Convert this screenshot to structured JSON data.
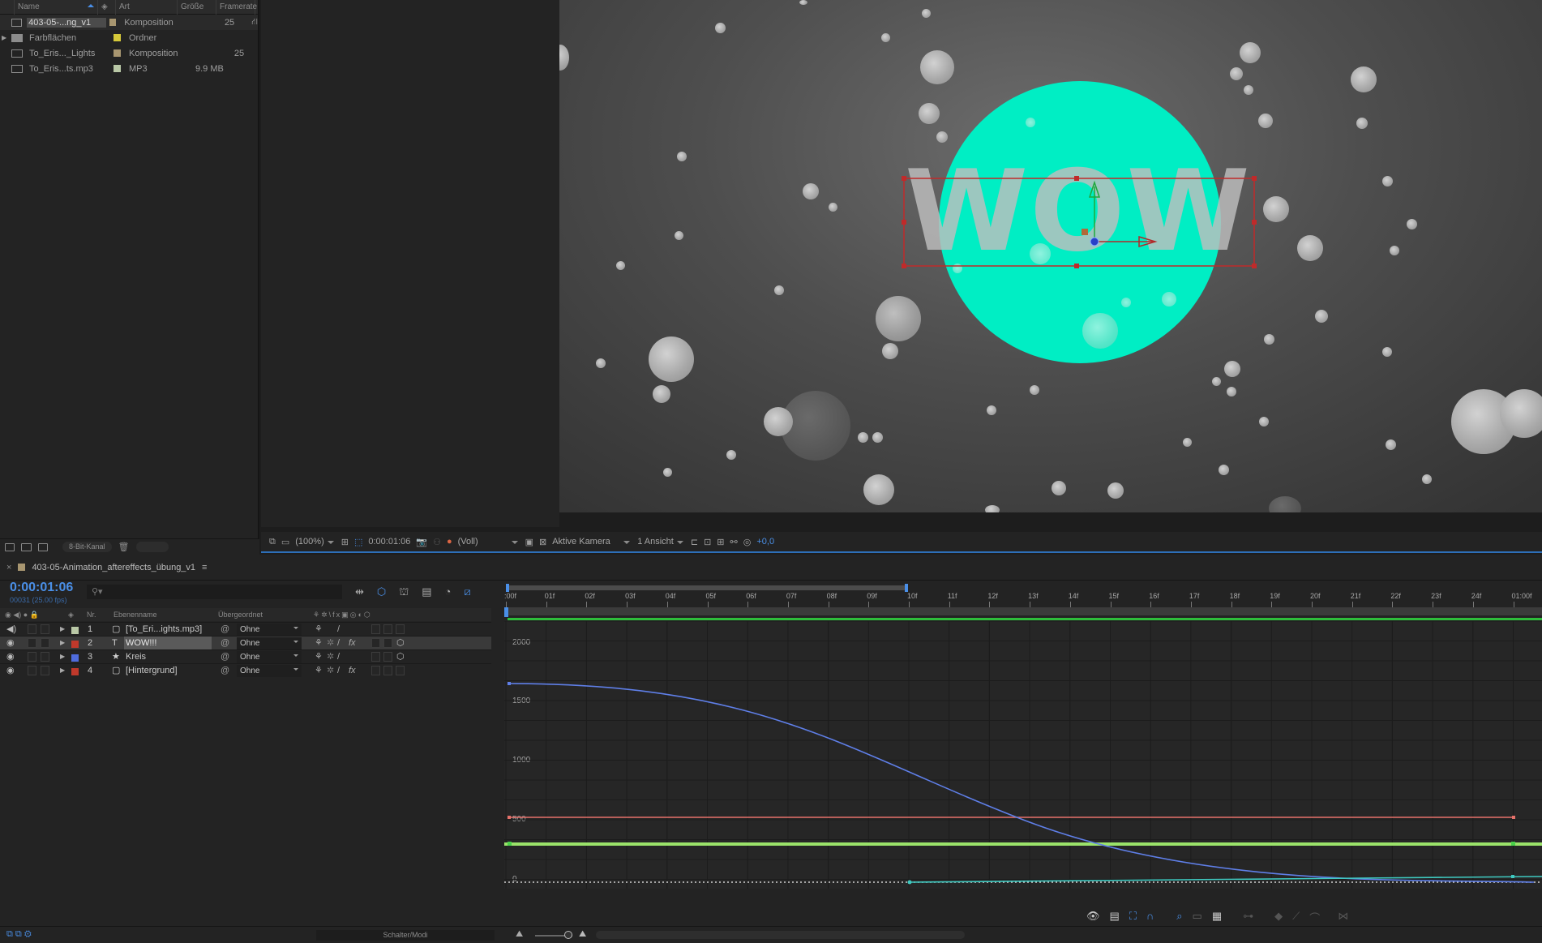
{
  "project": {
    "columns": {
      "name": "Name",
      "type": "Art",
      "size": "Größe",
      "framerate": "Framerate"
    },
    "items": [
      {
        "name": "403-05-...ng_v1",
        "type": "Komposition",
        "size": "",
        "framerate": "25",
        "swatch": "#a89670",
        "selected": true
      },
      {
        "name": "Farbflächen",
        "type": "Ordner",
        "size": "",
        "framerate": "",
        "swatch": "#d6c93a",
        "selected": false
      },
      {
        "name": "To_Eris..._Lights",
        "type": "Komposition",
        "size": "",
        "framerate": "25",
        "swatch": "#a89670",
        "selected": false
      },
      {
        "name": "To_Eris...ts.mp3",
        "type": "MP3",
        "size": "9.9 MB",
        "framerate": "",
        "swatch": "#b9c8a6",
        "selected": false
      }
    ],
    "bit_depth": "8-Bit-Kanal"
  },
  "viewer": {
    "overlay_text": "WOW!",
    "circle_color": "#00eec4",
    "zoom": "(100%)",
    "timecode": "0:00:01:06",
    "resolution": "(Voll)",
    "camera": "Aktive Kamera",
    "views": "1 Ansicht",
    "exposure": "+0,0"
  },
  "timeline": {
    "comp_tab": "403-05-Animation_aftereffects_übung_v1",
    "current_time": "0:00:01:06",
    "frame_info": "00031 (25.00 fps)",
    "search_placeholder": "",
    "columns": {
      "nr": "Nr.",
      "layer_name": "Ebenenname",
      "parent": "Übergeordnet"
    },
    "layers": [
      {
        "nr": "1",
        "name": "[To_Eri...ights.mp3]",
        "parent": "Ohne",
        "color": "#b9c8a6",
        "type": "audio",
        "selected": false
      },
      {
        "nr": "2",
        "name": "WOW!!!",
        "parent": "Ohne",
        "color": "#c0392b",
        "type": "text",
        "selected": true
      },
      {
        "nr": "3",
        "name": "Kreis",
        "parent": "Ohne",
        "color": "#4f6cdd",
        "type": "shape",
        "selected": false
      },
      {
        "nr": "4",
        "name": "[Hintergrund]",
        "parent": "Ohne",
        "color": "#c0392b",
        "type": "solid",
        "selected": false
      }
    ],
    "ruler_ticks": [
      ":00f",
      "01f",
      "02f",
      "03f",
      "04f",
      "05f",
      "06f",
      "07f",
      "08f",
      "09f",
      "10f",
      "11f",
      "12f",
      "13f",
      "14f",
      "15f",
      "16f",
      "17f",
      "18f",
      "19f",
      "20f",
      "21f",
      "22f",
      "23f",
      "24f",
      "01:00f"
    ],
    "graph_y_labels": [
      "2000",
      "1500",
      "1000",
      "500",
      "0"
    ],
    "footer_toggle": "Schalter/Modi"
  }
}
